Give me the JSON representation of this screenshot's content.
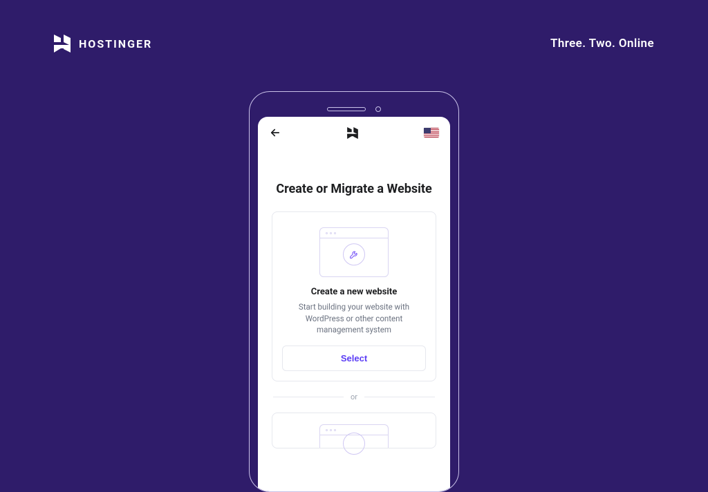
{
  "brand": {
    "name": "HOSTINGER",
    "tagline": "Three. Two. Online"
  },
  "app": {
    "pageTitle": "Create or Migrate a Website",
    "dividerLabel": "or",
    "card1": {
      "title": "Create a new website",
      "subtitle": "Start building your website with WordPress or other content management system",
      "selectLabel": "Select"
    },
    "locale": {
      "flag": "us"
    }
  }
}
